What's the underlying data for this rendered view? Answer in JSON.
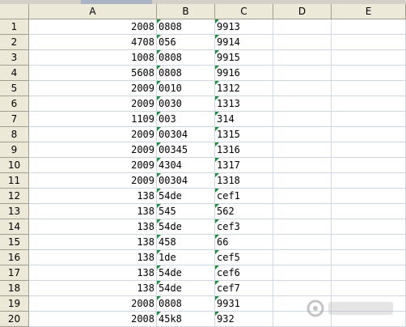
{
  "columns": [
    "A",
    "B",
    "C",
    "D",
    "E"
  ],
  "rows": [
    {
      "n": "1",
      "a": "2008",
      "b": "0808",
      "c": "9913"
    },
    {
      "n": "2",
      "a": "4708",
      "b": "056",
      "c": "9914"
    },
    {
      "n": "3",
      "a": "1008",
      "b": "0808",
      "c": "9915"
    },
    {
      "n": "4",
      "a": "5608",
      "b": "0808",
      "c": "9916"
    },
    {
      "n": "5",
      "a": "2009",
      "b": "0010",
      "c": "1312"
    },
    {
      "n": "6",
      "a": "2009",
      "b": "0030",
      "c": "1313"
    },
    {
      "n": "7",
      "a": "1109",
      "b": "003",
      "c": "314"
    },
    {
      "n": "8",
      "a": "2009",
      "b": "00304",
      "c": "1315"
    },
    {
      "n": "9",
      "a": "2009",
      "b": "00345",
      "c": "1316"
    },
    {
      "n": "10",
      "a": "2009",
      "b": "4304",
      "c": "1317"
    },
    {
      "n": "11",
      "a": "2009",
      "b": "00304",
      "c": "1318"
    },
    {
      "n": "12",
      "a": "138",
      "b": "54de",
      "c": "cef1"
    },
    {
      "n": "13",
      "a": "138",
      "b": "545",
      "c": "562"
    },
    {
      "n": "14",
      "a": "138",
      "b": "54de",
      "c": "cef3"
    },
    {
      "n": "15",
      "a": "138",
      "b": "458",
      "c": "66"
    },
    {
      "n": "16",
      "a": "138",
      "b": "1de",
      "c": "cef5"
    },
    {
      "n": "17",
      "a": "138",
      "b": "54de",
      "c": "cef6"
    },
    {
      "n": "18",
      "a": "138",
      "b": "54de",
      "c": "cef7"
    },
    {
      "n": "19",
      "a": "2008",
      "b": "0808",
      "c": "9931"
    },
    {
      "n": "20",
      "a": "2008",
      "b": "45k8",
      "c": "932"
    }
  ],
  "colors": {
    "header_bg": "#ece9d8",
    "grid": "#d0d7e5",
    "text_marker": "#1e8c3a"
  }
}
